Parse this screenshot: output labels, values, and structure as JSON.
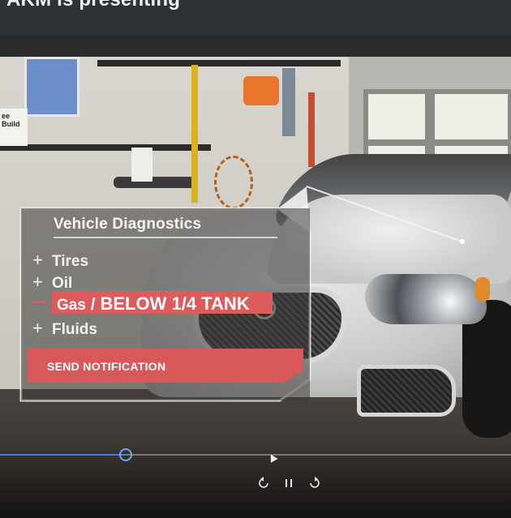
{
  "header": {
    "presenting_text": "AKM is presenting"
  },
  "poster": {
    "sign_text": "ee\nBuild"
  },
  "diagnostics": {
    "title": "Vehicle Diagnostics",
    "items": [
      {
        "sign": "+",
        "label": "Tires"
      },
      {
        "sign": "+",
        "label": "Oil"
      },
      {
        "sign": "+",
        "label": "Fluids"
      }
    ],
    "alert": {
      "label": "Gas",
      "separator": "/",
      "status": "BELOW 1/4 TANK"
    },
    "action_label": "SEND NOTIFICATION",
    "accent_color": "#dd5b5b"
  },
  "player": {
    "progress_fraction": 0.245,
    "icons": [
      "rewind-icon",
      "pause-icon",
      "forward-icon"
    ],
    "accent_color": "#3b82d6"
  }
}
